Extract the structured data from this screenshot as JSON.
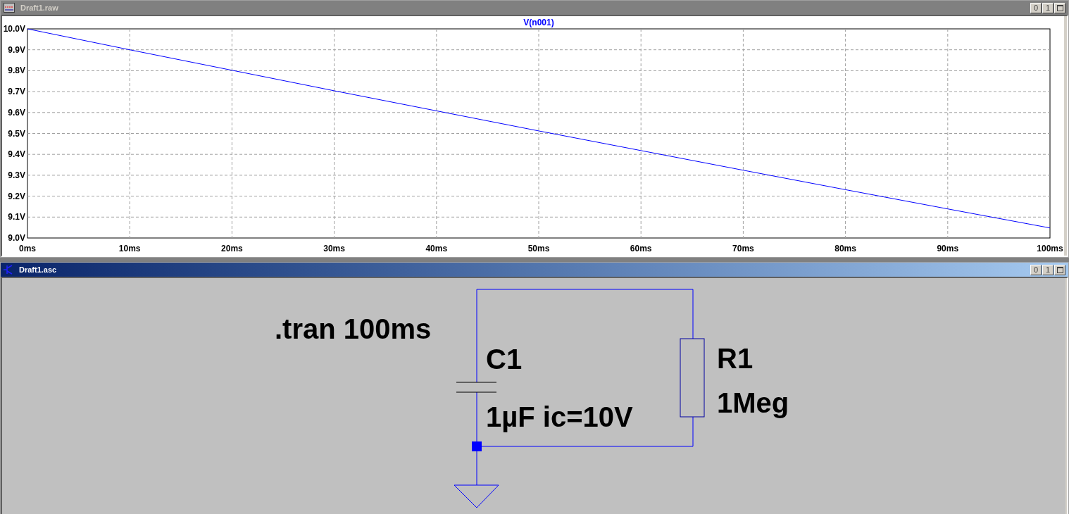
{
  "windows": [
    {
      "title": "Draft1.raw",
      "kind": "waveform",
      "active": false,
      "buttons": [
        "0",
        "1"
      ],
      "chart_data": {
        "type": "line",
        "grid": true,
        "x": [
          0,
          10,
          20,
          30,
          40,
          50,
          60,
          70,
          80,
          90,
          100
        ],
        "series": [
          {
            "name": "V(n001)",
            "color": "#0000ff",
            "values": [
              10.0,
              9.9,
              9.802,
              9.704,
              9.608,
              9.512,
              9.418,
              9.324,
              9.231,
              9.139,
              9.048
            ]
          }
        ],
        "xlim": [
          0,
          100
        ],
        "ylim": [
          9.0,
          10.0
        ],
        "xticks": [
          {
            "value": 0,
            "label": "0ms"
          },
          {
            "value": 10,
            "label": "10ms"
          },
          {
            "value": 20,
            "label": "20ms"
          },
          {
            "value": 30,
            "label": "30ms"
          },
          {
            "value": 40,
            "label": "40ms"
          },
          {
            "value": 50,
            "label": "50ms"
          },
          {
            "value": 60,
            "label": "60ms"
          },
          {
            "value": 70,
            "label": "70ms"
          },
          {
            "value": 80,
            "label": "80ms"
          },
          {
            "value": 90,
            "label": "90ms"
          },
          {
            "value": 100,
            "label": "100ms"
          }
        ],
        "yticks": [
          {
            "value": 9.0,
            "label": "9.0V"
          },
          {
            "value": 9.1,
            "label": "9.1V"
          },
          {
            "value": 9.2,
            "label": "9.2V"
          },
          {
            "value": 9.3,
            "label": "9.3V"
          },
          {
            "value": 9.4,
            "label": "9.4V"
          },
          {
            "value": 9.5,
            "label": "9.5V"
          },
          {
            "value": 9.6,
            "label": "9.6V"
          },
          {
            "value": 9.7,
            "label": "9.7V"
          },
          {
            "value": 9.8,
            "label": "9.8V"
          },
          {
            "value": 9.9,
            "label": "9.9V"
          },
          {
            "value": 10.0,
            "label": "10.0V"
          }
        ]
      }
    },
    {
      "title": "Draft1.asc",
      "kind": "schematic",
      "active": true,
      "buttons": [
        "0",
        "1"
      ],
      "directive": ".tran 100ms",
      "components": [
        {
          "kind": "capacitor",
          "name": "C1",
          "value": "1µF ic=10V"
        },
        {
          "kind": "resistor",
          "name": "R1",
          "value": "1Meg"
        }
      ]
    }
  ]
}
